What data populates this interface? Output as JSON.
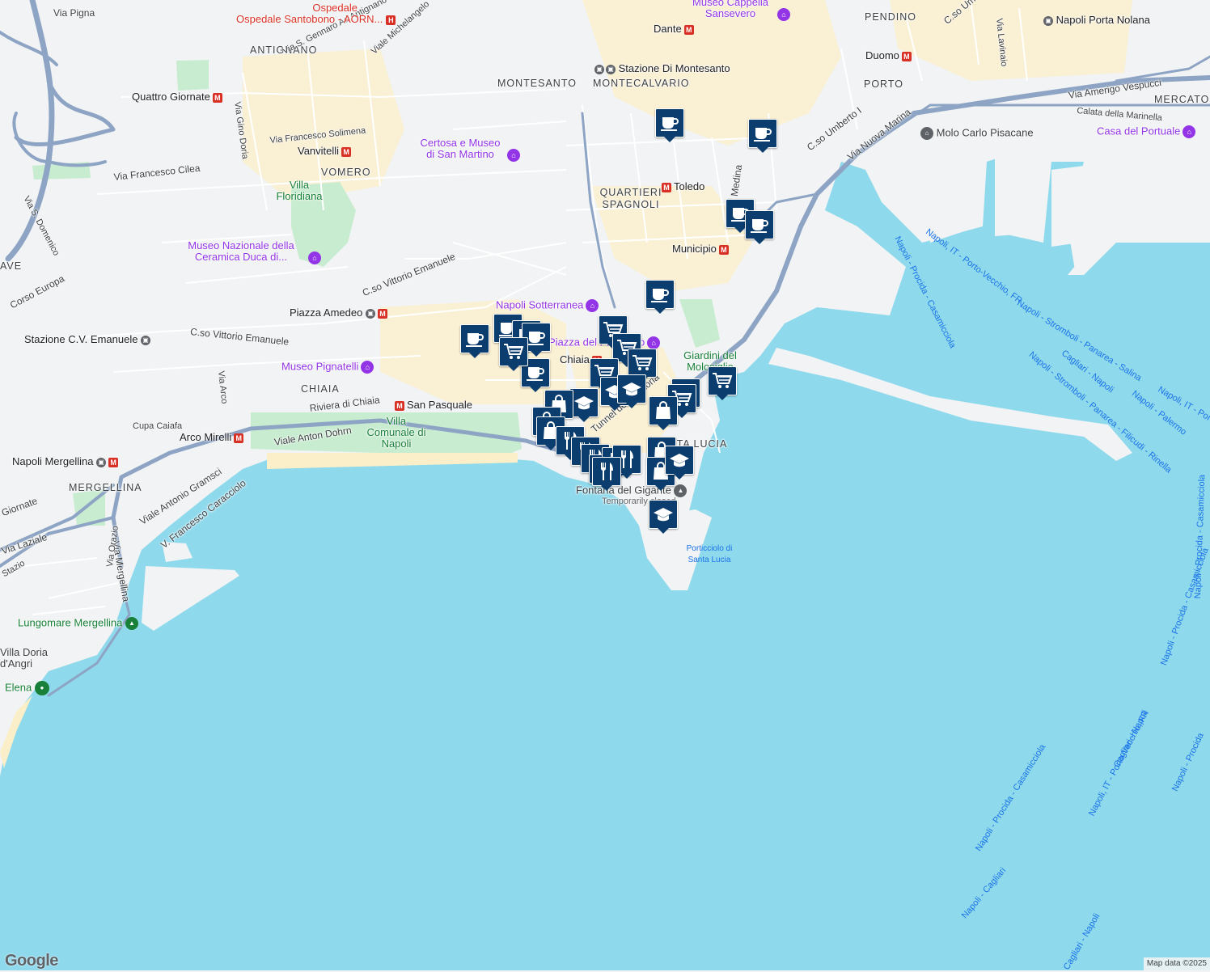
{
  "map": {
    "colors": {
      "land": "#f1f3f4",
      "water": "#8fd9ec",
      "road_major": "#8ea4c4",
      "road_minor": "#ffffff",
      "park": "#c8ecd0",
      "commercial": "#fbf0d0",
      "beach": "#fbefc9",
      "marker": "#0b3d6e"
    },
    "districts": [
      "ANTIGNANO",
      "VOMERO",
      "MONTESANTO",
      "MONTECALVARIO",
      "PENDINO",
      "PORTO",
      "MERCATO",
      "QUARTIERI SPAGNOLI",
      "CHIAIA",
      "MERGELLINA",
      "AVE",
      "SANTA LUCIA"
    ],
    "streets": [
      "Via Pigna",
      "Via S. Gennaro Ad Antignano",
      "Viale Michelangelo",
      "Via Gino Doria",
      "Via Francesco Solimena",
      "Via Francesco Cilea",
      "Corso Europa",
      "C.so Vittorio Emanuele",
      "C.so Vittorio Emanuele",
      "Via S. Domenico",
      "Riviera di Chiaia",
      "Viale Anton Dohrn",
      "Viale Antonio Gramsci",
      "V. Francesco Caracciolo",
      "Via Mergellina",
      "Via Orazio",
      "Cupa Caiafa",
      "Via Nuova Marina",
      "C.so Umberto I",
      "Via Amerigo Vespucci",
      "Calata della Marinella",
      "Via Lavinaio",
      "C.so Umb",
      "Via Arco",
      "Tunnel della Vittoria",
      "Via Medina",
      "Via Laziale",
      "Giornate",
      "Stazio"
    ],
    "pois": [
      {
        "name": "Ospedale Santobono - AORN...",
        "kind": "hospital"
      },
      {
        "name": "Museo Cappella Sansevero",
        "kind": "museum"
      },
      {
        "name": "Certosa e Museo di San Martino",
        "kind": "museum"
      },
      {
        "name": "Museo Nazionale della Ceramica Duca di...",
        "kind": "museum"
      },
      {
        "name": "Napoli Sotterranea",
        "kind": "museum"
      },
      {
        "name": "Museo Pignatelli",
        "kind": "museum"
      },
      {
        "name": "Molo Carlo Pisacane",
        "kind": "landmark"
      },
      {
        "name": "Casa del Portuale",
        "kind": "museum"
      },
      {
        "name": "Piazza del Plebiscito",
        "kind": "museum"
      },
      {
        "name": "Villa Floridiana",
        "kind": "park"
      },
      {
        "name": "Villa Comunale di Napoli",
        "kind": "park"
      },
      {
        "name": "Giardini del Molosiglio",
        "kind": "park"
      },
      {
        "name": "Lungomare Mergellina",
        "kind": "park"
      },
      {
        "name": "Villa Doria d'Angri",
        "kind": "school"
      },
      {
        "name": "Elena",
        "kind": "park"
      },
      {
        "name": "Fontana del Gigante",
        "kind": "landmark"
      },
      {
        "name": "Temporarily closed",
        "kind": "note"
      },
      {
        "name": "Porticciolo di Santa Lucia",
        "kind": "water"
      }
    ],
    "stations": [
      "Dante",
      "Stazione Di Montesanto",
      "Duomo",
      "Napoli Porta Nolana",
      "Quattro Giornate",
      "Vanvitelli",
      "Toledo",
      "Municipio",
      "Piazza Amedeo",
      "Stazione C.V. Emanuele",
      "Chiaia",
      "San Pasquale",
      "Arco Mirelli",
      "Napoli Mergellina"
    ],
    "ferry_routes": [
      "Napoli, IT - Porto-Vecchio, FR",
      "Napoli - Procida - Casamicciola",
      "Napoli - Stromboli - Panarea - Salina",
      "Napoli - Palermo",
      "Napoli, IT - Porto",
      "Cagliari - Napoli",
      "Napoli - Stromboli - Panarea - Filicudi - Rinella",
      "Napoli - Procida - Casamicciola",
      "Cagliari - Napoli",
      "Napoli, IT - Porto-Vecchio, FR",
      "Napoli - Cagliari",
      "Napoli - Procida - Casamicciola",
      "Napoli - Procida",
      "Napoli - Procida - Casamicciola",
      "Cagliari - Napoli"
    ],
    "markers": [
      {
        "icon": "coffee"
      },
      {
        "icon": "coffee"
      },
      {
        "icon": "coffee"
      },
      {
        "icon": "coffee"
      },
      {
        "icon": "coffee"
      },
      {
        "icon": "coffee"
      },
      {
        "icon": "coffee"
      },
      {
        "icon": "coffee"
      },
      {
        "icon": "coffee"
      },
      {
        "icon": "coffee"
      },
      {
        "icon": "cart"
      },
      {
        "icon": "cart"
      },
      {
        "icon": "cart"
      },
      {
        "icon": "cart"
      },
      {
        "icon": "cart"
      },
      {
        "icon": "cart"
      },
      {
        "icon": "cart"
      },
      {
        "icon": "cart"
      },
      {
        "icon": "school"
      },
      {
        "icon": "school"
      },
      {
        "icon": "school"
      },
      {
        "icon": "school"
      },
      {
        "icon": "bag"
      },
      {
        "icon": "bag"
      },
      {
        "icon": "bag"
      },
      {
        "icon": "bag"
      },
      {
        "icon": "bag"
      },
      {
        "icon": "bag"
      },
      {
        "icon": "fork"
      },
      {
        "icon": "fork"
      },
      {
        "icon": "fork"
      },
      {
        "icon": "fork"
      },
      {
        "icon": "fork"
      },
      {
        "icon": "fork"
      },
      {
        "icon": "fork"
      },
      {
        "icon": "school"
      }
    ],
    "logo": "Google",
    "attribution": "Map data ©2025"
  }
}
